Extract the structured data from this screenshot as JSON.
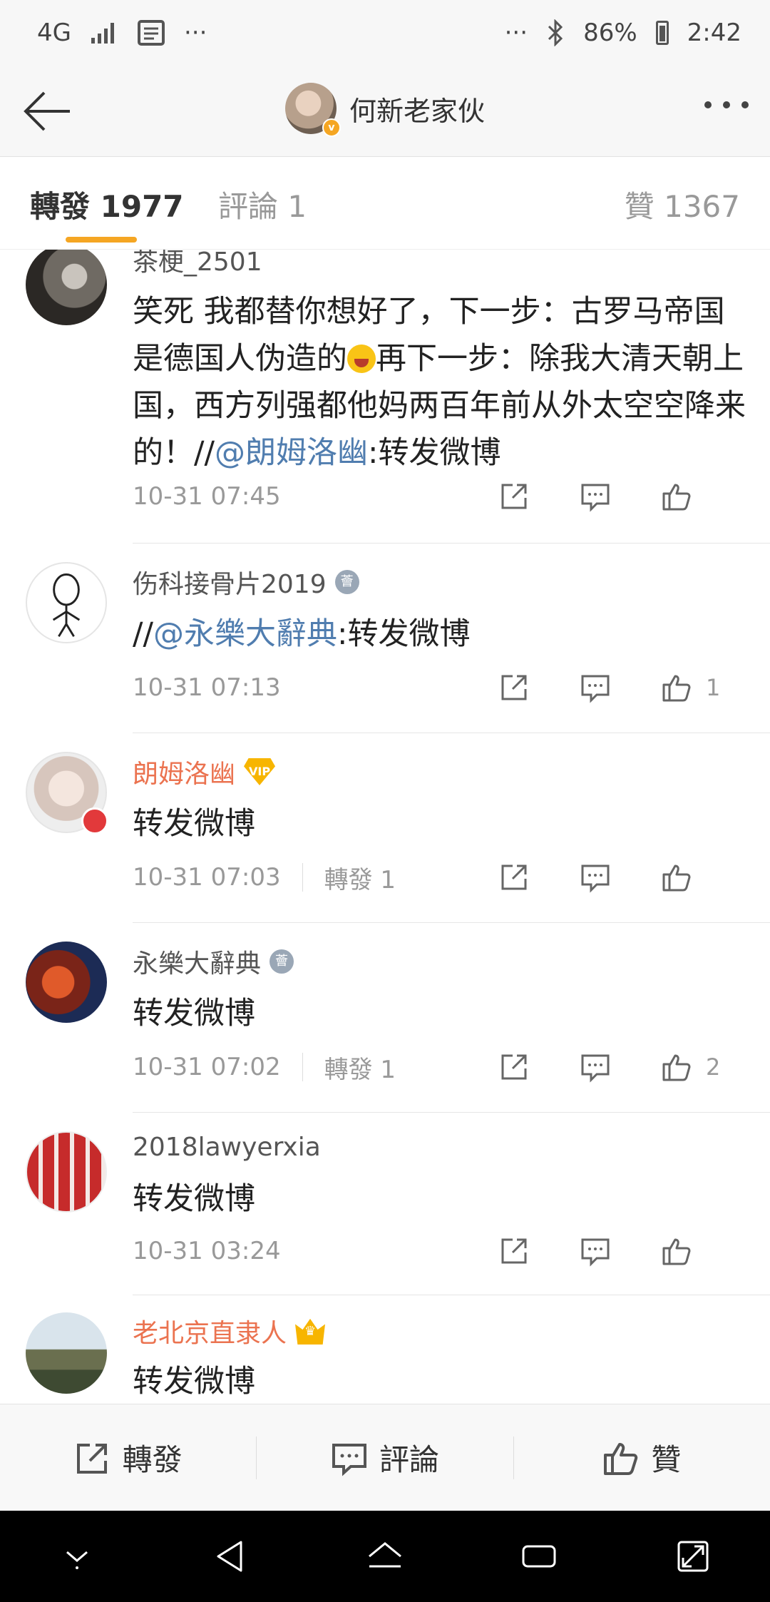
{
  "status_bar": {
    "network": "4G",
    "more_left": "···",
    "more_right": "···",
    "battery": "86%",
    "time": "2:42"
  },
  "nav": {
    "title": "何新老家伙",
    "verified": "v"
  },
  "tabs": {
    "repost": "轉發 1977",
    "comment": "評論 1",
    "like": "贊 1367"
  },
  "items": [
    {
      "username": "茶梗_2501",
      "text_before": "笑死 我都替你想好了，下一步：古罗马帝国是德国人伪造的",
      "text_mid": "再下一步：除我大清天朝上国，西方列强都他妈两百年前从外太空空降来的！//",
      "mention": "@朗姆洛幽",
      "text_after": ":转发微博",
      "time": "10-31 07:45",
      "likes": ""
    },
    {
      "username": "伤科接骨片2019",
      "text_before": "//",
      "mention": "@永樂大辭典",
      "text_after": ":转发微博",
      "time": "10-31 07:13",
      "likes": "1"
    },
    {
      "username": "朗姆洛幽",
      "text": "转发微博",
      "time": "10-31 07:03",
      "reposts": "轉發 1",
      "likes": ""
    },
    {
      "username": "永樂大辭典",
      "text": "转发微博",
      "time": "10-31 07:02",
      "reposts": "轉發 1",
      "likes": "2"
    },
    {
      "username": "2018lawyerxia",
      "text": "转发微博",
      "time": "10-31 03:24",
      "likes": ""
    },
    {
      "username": "老北京直隶人",
      "text": "转发微博"
    }
  ],
  "badges": {
    "medal": "薈",
    "vip": "VIP",
    "crown": "♛"
  },
  "bottom_bar": {
    "repost": "轉發",
    "comment": "評論",
    "like": "贊"
  },
  "colors": {
    "accent": "#f5a623",
    "mention": "#507daf",
    "vip_name": "#eb7350"
  }
}
